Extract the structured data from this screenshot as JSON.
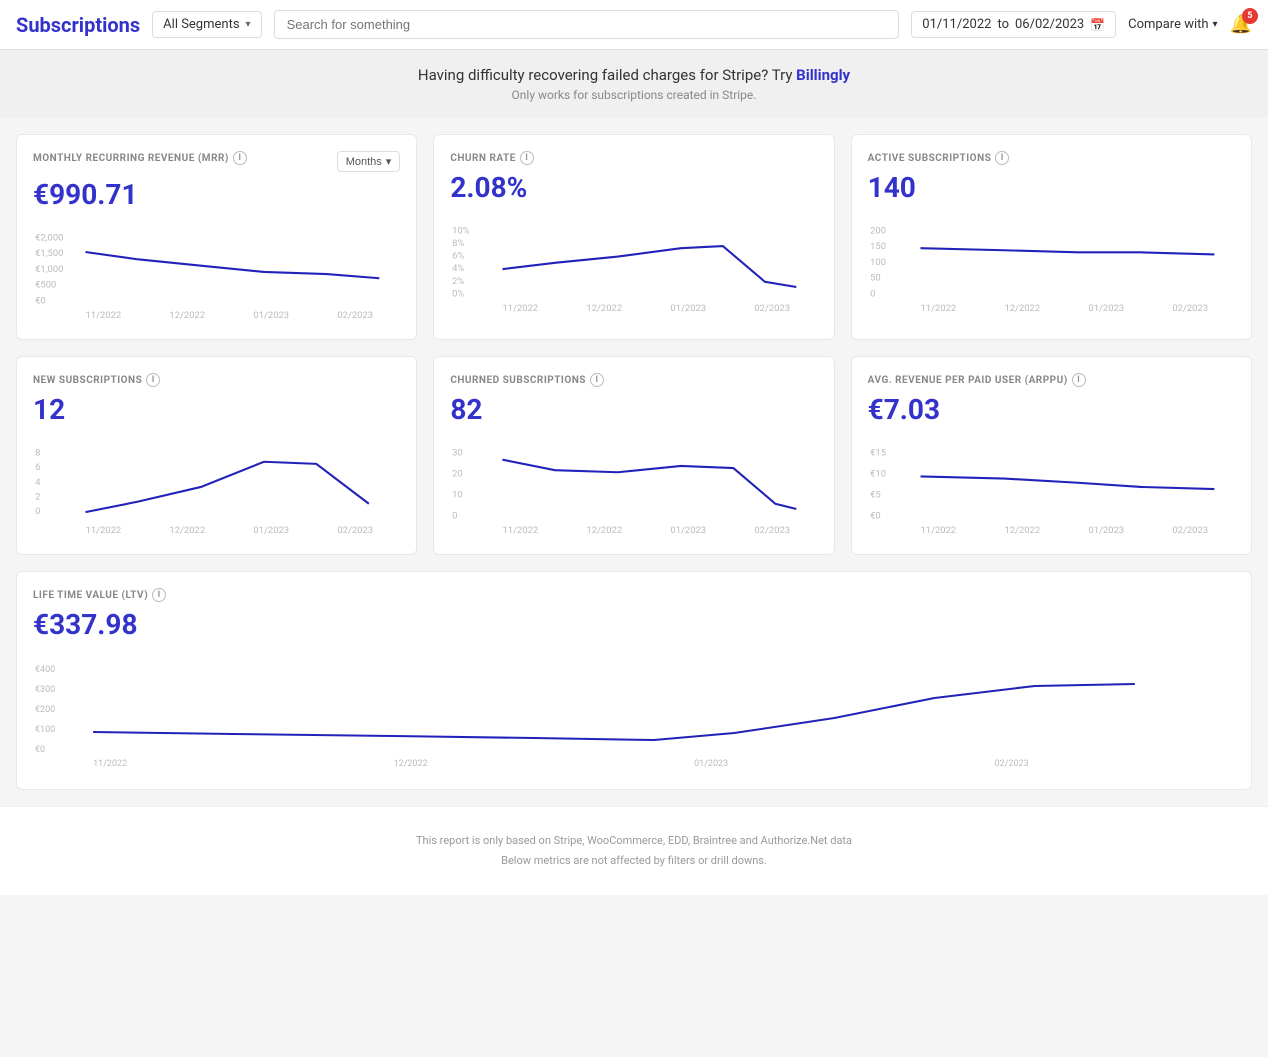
{
  "header": {
    "title": "Subscriptions",
    "segment_label": "All Segments",
    "search_placeholder": "Search for something",
    "date_from": "01/11/2022",
    "date_to": "06/02/2023",
    "compare_label": "Compare with",
    "notification_count": "5"
  },
  "banner": {
    "text_before": "Having difficulty recovering failed charges for Stripe? Try ",
    "link_text": "Billingly",
    "text_after": "",
    "subtitle": "Only works for subscriptions created in Stripe."
  },
  "cards": {
    "mrr": {
      "label": "MONTHLY RECURRING REVENUE (MRR)",
      "value": "€990.71",
      "months_label": "Months"
    },
    "churn": {
      "label": "CHURN RATE",
      "value": "2.08%"
    },
    "active_subs": {
      "label": "ACTIVE SUBSCRIPTIONS",
      "value": "140"
    },
    "new_subs": {
      "label": "NEW SUBSCRIPTIONS",
      "value": "12"
    },
    "churned_subs": {
      "label": "CHURNED SUBSCRIPTIONS",
      "value": "82"
    },
    "arppu": {
      "label": "AVG. REVENUE PER PAID USER (ARPPU)",
      "value": "€7.03"
    },
    "ltv": {
      "label": "LIFE TIME VALUE (LTV)",
      "value": "€337.98"
    }
  },
  "footer": {
    "line1": "This report is only based on Stripe, WooCommerce, EDD, Braintree and Authorize.Net data",
    "line2": "Below metrics are not affected by filters or drill downs."
  },
  "x_labels": [
    "11/2022",
    "12/2022",
    "01/2023",
    "02/2023"
  ],
  "icons": {
    "chevron_down": "▾",
    "info": "i",
    "calendar": "📅",
    "bell": "🔔"
  }
}
